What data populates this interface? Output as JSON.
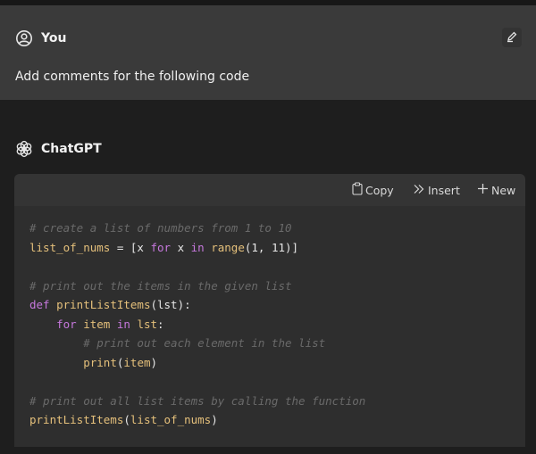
{
  "user_message": {
    "author": "You",
    "text": "Add comments for the following code",
    "edit_icon": "edit-icon"
  },
  "assistant_message": {
    "author": "ChatGPT"
  },
  "code_toolbar": {
    "copy_label": "Copy",
    "insert_label": "Insert",
    "new_label": "New"
  },
  "code_lines": [
    "# create a list of numbers from 1 to 10",
    "list_of_nums = [x for x in range(1, 11)]",
    "",
    "# print out the items in the given list",
    "def printListItems(lst):",
    "    for item in lst:",
    "        # print out each element in the list",
    "        print(item)",
    "",
    "# print out all list items by calling the function",
    "printListItems(list_of_nums)"
  ],
  "colors": {
    "background": "#1e1e1e",
    "user_bg": "#3a3a3a",
    "code_bg": "#2e2e2e",
    "comment": "#6a6a6a",
    "keyword": "#c678dd",
    "identifier": "#e5c07b"
  }
}
